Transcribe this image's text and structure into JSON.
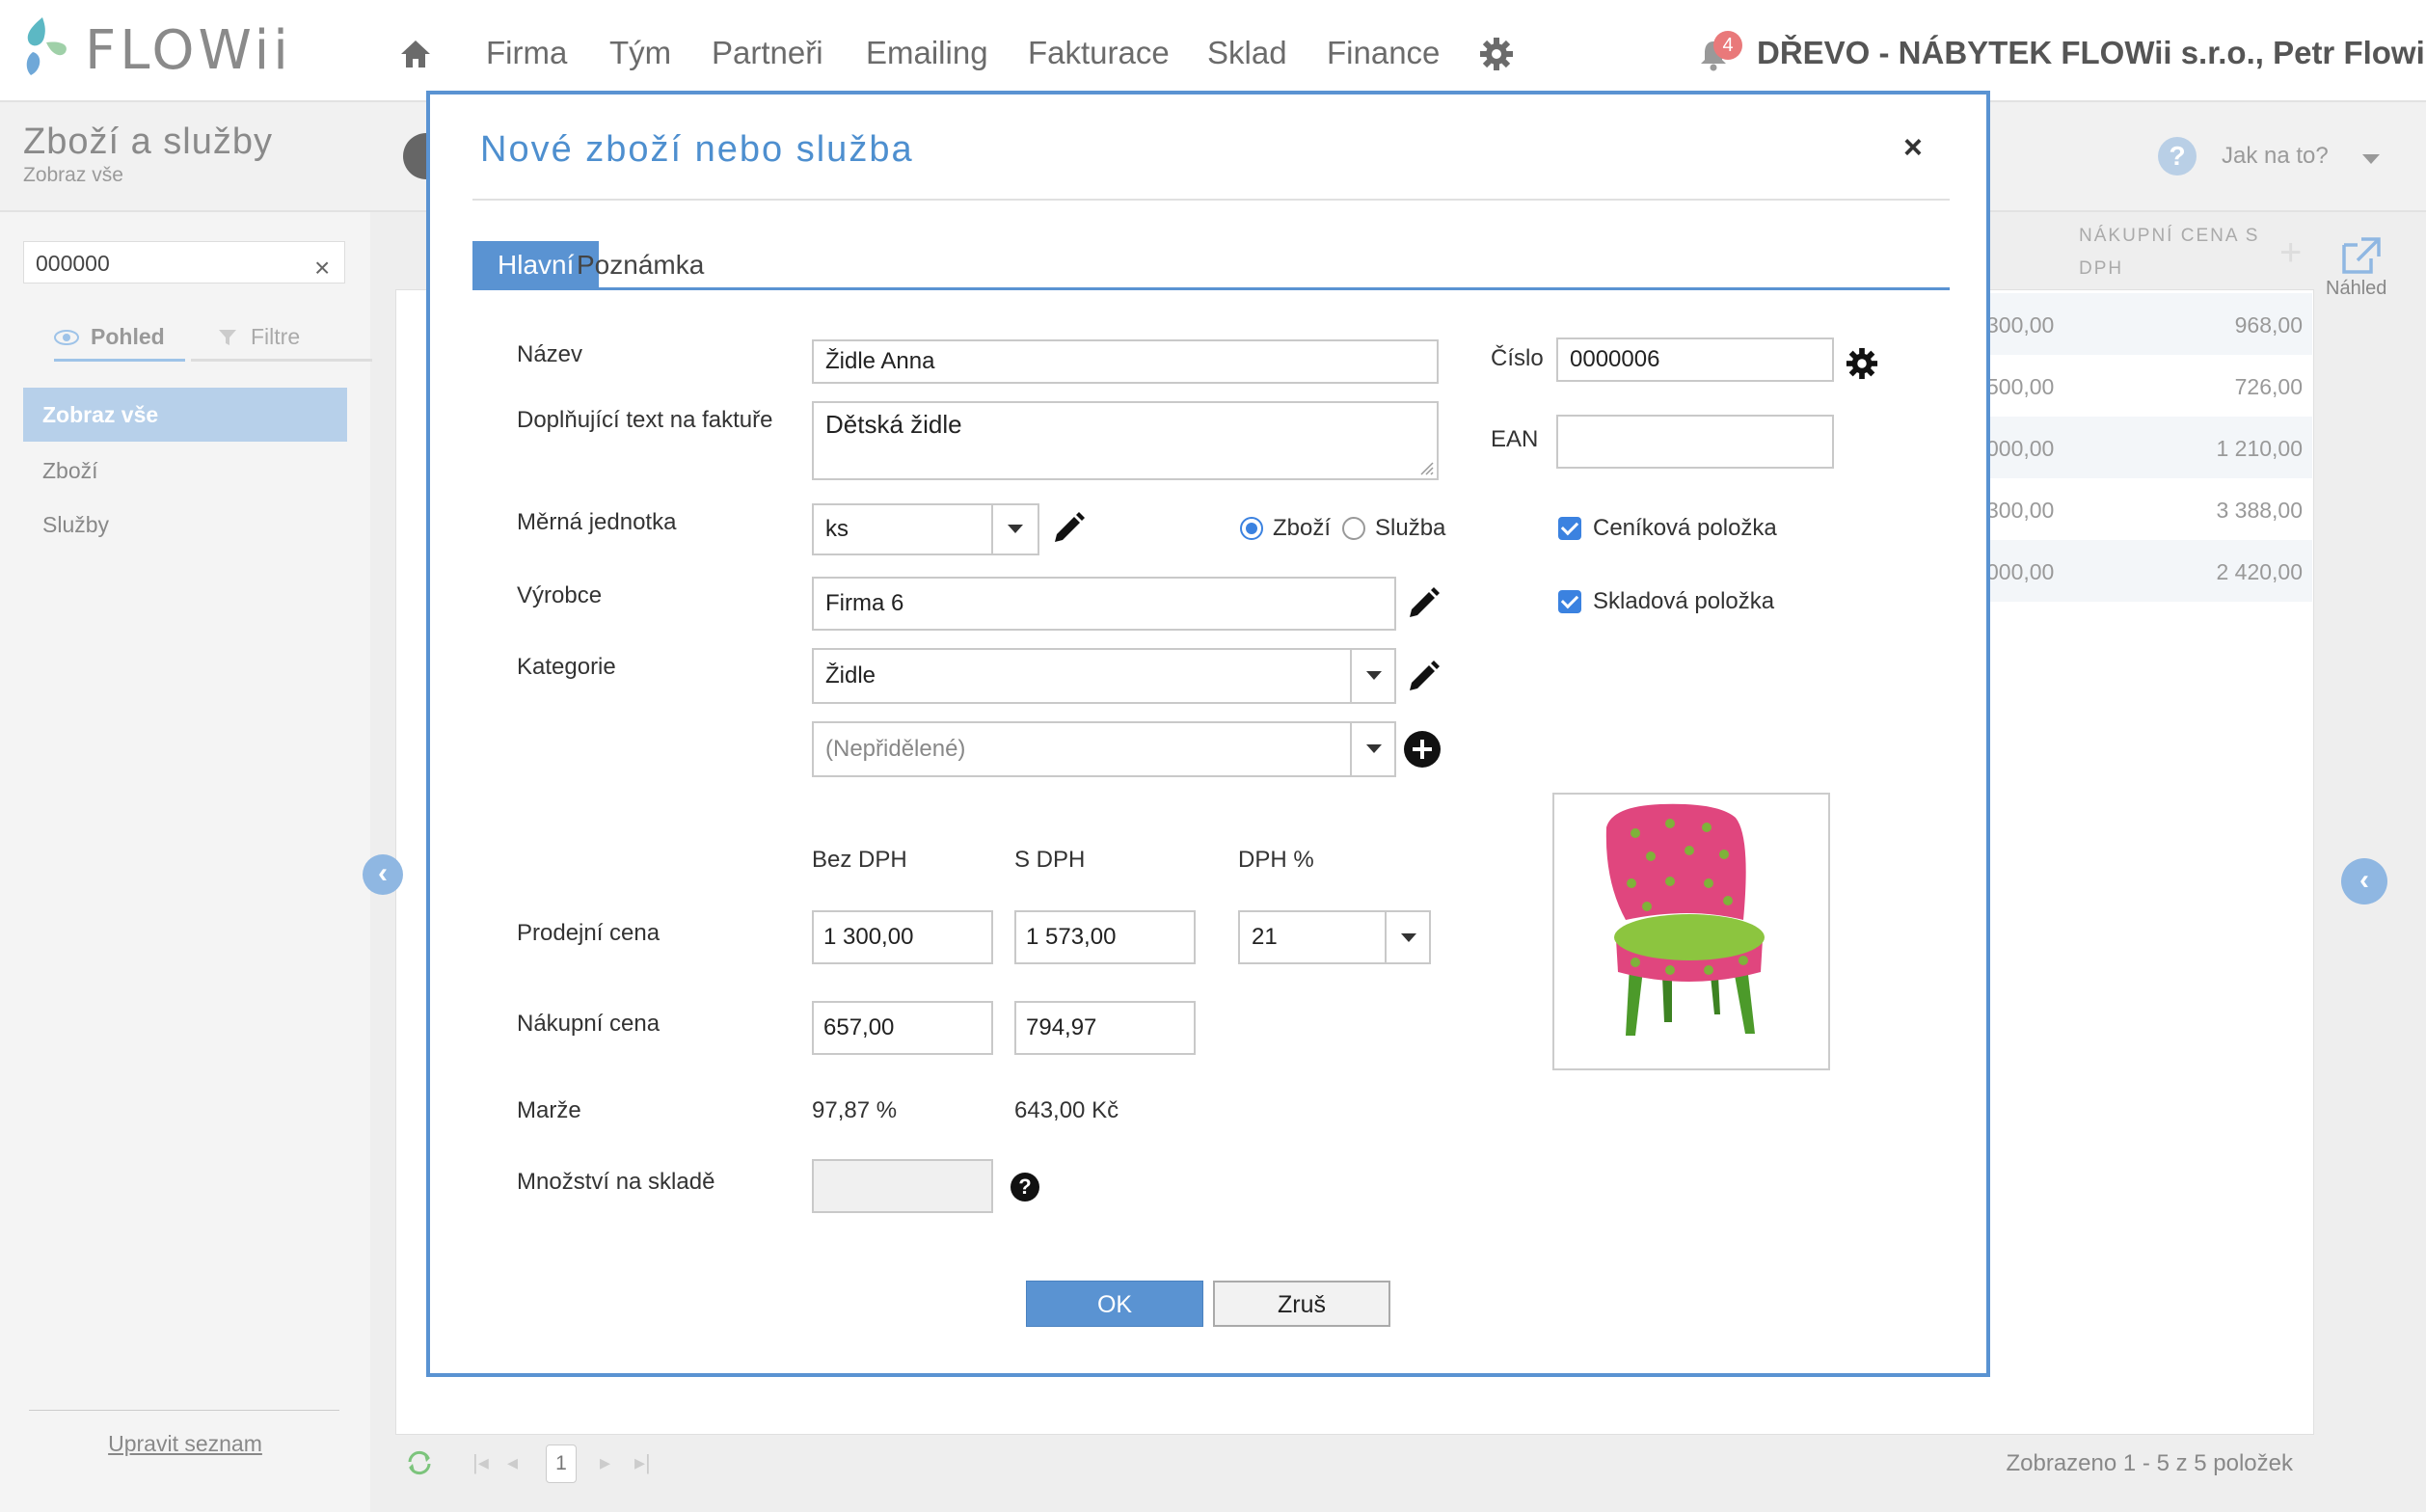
{
  "brand": {
    "logo_text": "FLOWii"
  },
  "nav": {
    "items": [
      "Firma",
      "Tým",
      "Partneři",
      "Emailing",
      "Fakturace",
      "Sklad",
      "Finance"
    ]
  },
  "header": {
    "notifications_count": "4",
    "company_user": "DŘEVO - NÁBYTEK FLOWii s.r.o., Petr Flowii"
  },
  "page": {
    "title": "Zboží a služby",
    "subtitle": "Zobraz vše",
    "howto_label": "Jak na to?"
  },
  "sidebar": {
    "search_value": "000000",
    "tabs": [
      "Pohled",
      "Filtre"
    ],
    "items": [
      "Zobraz vše",
      "Zboží",
      "Služby"
    ],
    "edit_list_link": "Upravit seznam"
  },
  "table": {
    "column_header": "NÁKUPNÍ CENA S DPH",
    "preview_label": "Náhled",
    "rows": [
      {
        "partial": "300,00",
        "value": "968,00"
      },
      {
        "partial": "500,00",
        "value": "726,00"
      },
      {
        "partial": "000,00",
        "value": "1 210,00"
      },
      {
        "partial": "300,00",
        "value": "3 388,00"
      },
      {
        "partial": "000,00",
        "value": "2 420,00"
      }
    ],
    "pager": {
      "page": "1",
      "info": "Zobrazeno 1 - 5 z 5 položek"
    }
  },
  "modal": {
    "title": "Nové zboží nebo služba",
    "close_glyph": "×",
    "tabs": [
      "Hlavní",
      "Poznámka"
    ],
    "labels": {
      "name": "Název",
      "invoice_text": "Doplňující text na faktuře",
      "unit": "Měrná jednotka",
      "manufacturer": "Výrobce",
      "category": "Kategorie",
      "number": "Číslo",
      "ean": "EAN",
      "price_without_vat": "Bez DPH",
      "price_with_vat": "S DPH",
      "vat_percent": "DPH %",
      "sale_price": "Prodejní cena",
      "purchase_price": "Nákupní cena",
      "margin": "Marže",
      "stock_quantity": "Množství na skladě"
    },
    "values": {
      "name": "Židle Anna",
      "invoice_text": "Dětská židle",
      "unit": "ks",
      "manufacturer": "Firma 6",
      "category": "Židle",
      "subcategory_placeholder": "(Nepřidělené)",
      "number": "0000006",
      "ean": "",
      "sale_without_vat": "1 300,00",
      "sale_with_vat": "1 573,00",
      "vat_rate": "21",
      "purchase_without_vat": "657,00",
      "purchase_with_vat": "794,97",
      "margin_percent": "97,87 %",
      "margin_amount": "643,00 Kč",
      "stock_quantity": ""
    },
    "type_radio": {
      "options": [
        "Zboží",
        "Služba"
      ],
      "selected": "Zboží"
    },
    "checkboxes": [
      {
        "label": "Ceníková položka",
        "checked": true
      },
      {
        "label": "Skladová položka",
        "checked": true
      }
    ],
    "buttons": {
      "ok": "OK",
      "cancel": "Zruš"
    }
  },
  "colors": {
    "accent": "#5a93d2",
    "sidebar_active": "#b7d0ea",
    "badge": "#e9797a"
  }
}
